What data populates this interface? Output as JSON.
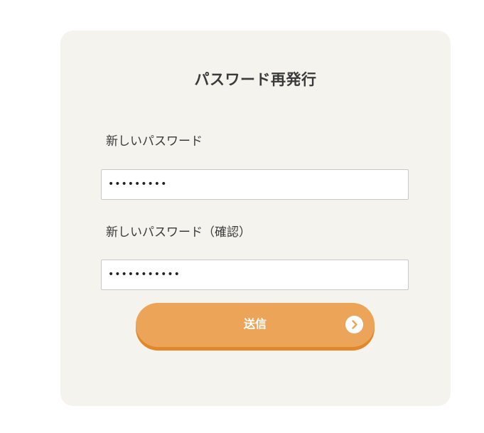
{
  "form": {
    "title": "パスワード再発行",
    "new_password_label": "新しいパスワード",
    "new_password_value": "•••••••••",
    "confirm_password_label": "新しいパスワード（確認）",
    "confirm_password_value": "•••••••••••",
    "submit_label": "送信"
  },
  "icons": {
    "submit_arrow": "chevron-right-icon"
  },
  "colors": {
    "card_background": "#f4f3ee",
    "button": "#eca458",
    "button_shadow": "#e2872a",
    "text": "#3a3a3a"
  }
}
